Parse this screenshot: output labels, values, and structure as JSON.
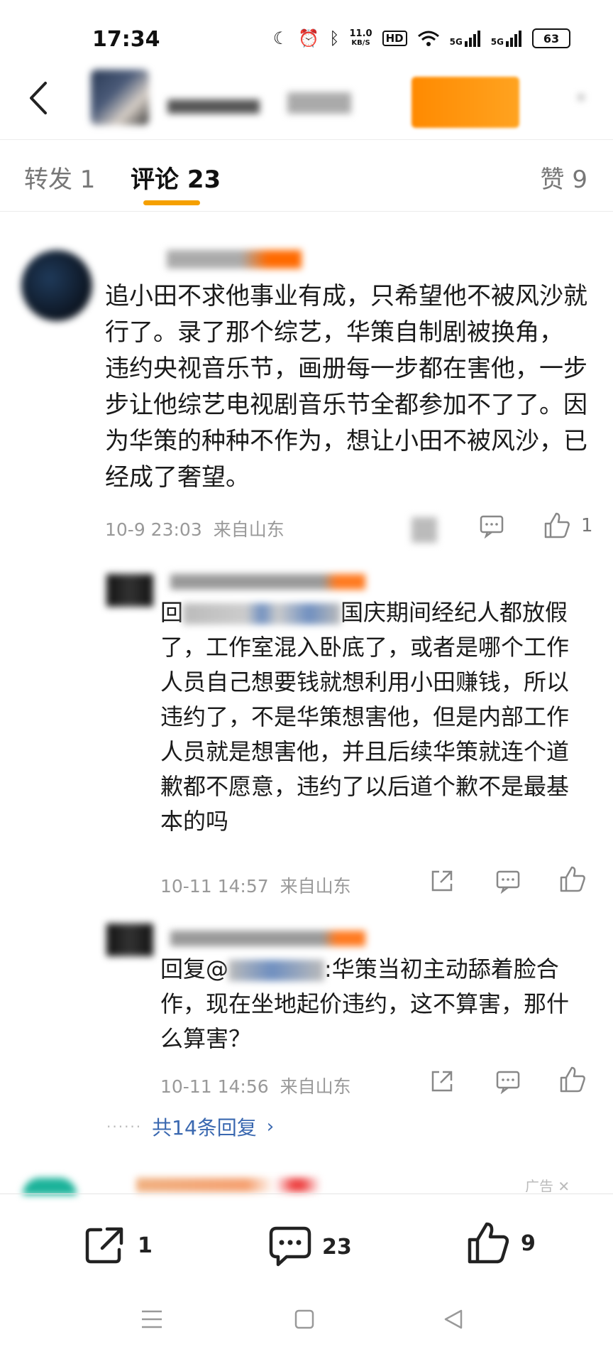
{
  "status": {
    "time": "17:34",
    "net_speed_top": "11.0",
    "net_speed_unit": "KB/S",
    "hd_label": "HD",
    "signal1": "5G",
    "signal2": "5G",
    "battery": "63"
  },
  "tabs": {
    "repost": "转发 1",
    "comment": "评论 23",
    "like": "赞 9"
  },
  "comment": {
    "text": "追小田不求他事业有成，只希望他不被风沙就行了。录了那个综艺，华策自制剧被换角， 违约央视音乐节，画册每一步都在害他，一步步让他综艺电视剧音乐节全都参加不了了。因为华策的种种不作为，想让小田不被风沙，已经成了奢望。",
    "time": "10-9 23:03",
    "location": "来自山东",
    "like_count": "1"
  },
  "replies": [
    {
      "prefix": "回",
      "text": "国庆期间经纪人都放假了，工作室混入卧底了，或者是哪个工作人员自己想要钱就想利用小田赚钱，所以违约了，不是华策想害他，但是内部工作人员就是想害他，并且后续华策就连个道歉都不愿意，违约了以后道个歉不是最基本的吗",
      "time": "10-11 14:57",
      "location": "来自山东"
    },
    {
      "prefix": "回复@",
      "text": ":华策当初主动舔着脸合作，现在坐地起价违约，这不算害，那什么算害？",
      "time": "10-11 14:56",
      "location": "来自山东"
    }
  ],
  "more_replies": "共14条回复",
  "ad_label": "广告",
  "bottom": {
    "repost_count": "1",
    "comment_count": "23",
    "like_count": "9"
  },
  "colors": {
    "accent": "#f5a000",
    "link": "#3a68b0",
    "meta": "#999999"
  }
}
